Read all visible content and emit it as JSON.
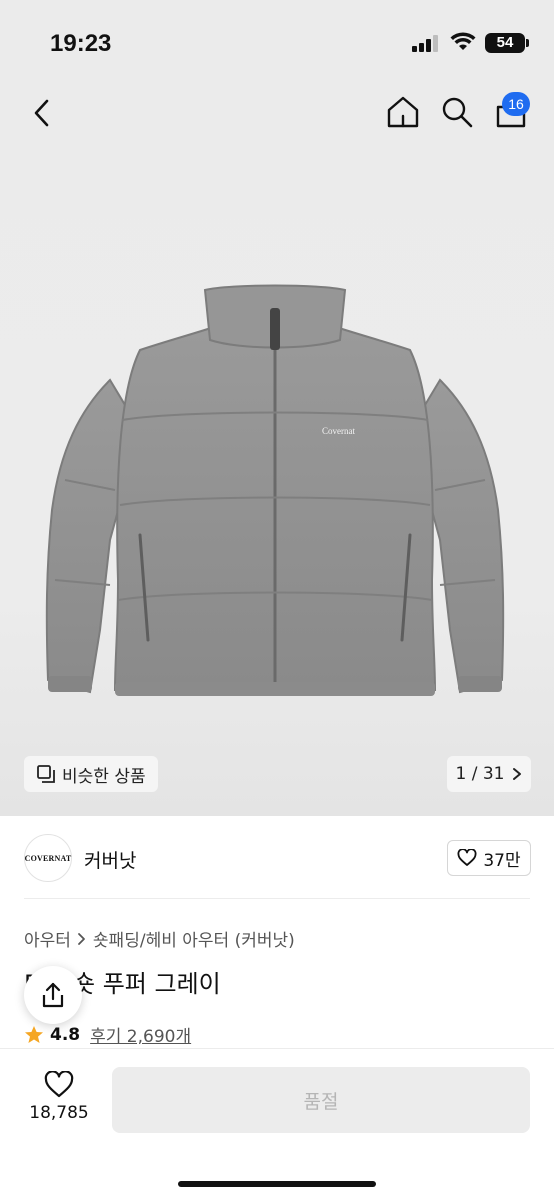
{
  "status": {
    "time": "19:23",
    "battery": "54"
  },
  "nav": {
    "cart_count": "16",
    "icons": [
      "back-arrow-icon",
      "home-icon",
      "search-icon",
      "cart-icon"
    ]
  },
  "gallery": {
    "similar_label": "비슷한 상품",
    "pager": "1 / 31",
    "jacket_logo_text": "Covernat",
    "colors": {
      "jacket": "#8f8f8f",
      "background": "#ebebeb"
    }
  },
  "brand": {
    "logo_text": "COVERNAT",
    "name": "커버낫",
    "likes": "37만"
  },
  "product": {
    "breadcrumb": [
      "아우터",
      "숏패딩/헤비 아우터 (커버낫)"
    ],
    "title": "D... 숏 푸퍼 그레이",
    "rating": "4.8",
    "reviews": "후기 2,690개"
  },
  "bottom": {
    "wish_count": "18,785",
    "buy_label": "품절"
  },
  "accent": {
    "badge": "#1f6cf0",
    "star": "#f5a623"
  }
}
